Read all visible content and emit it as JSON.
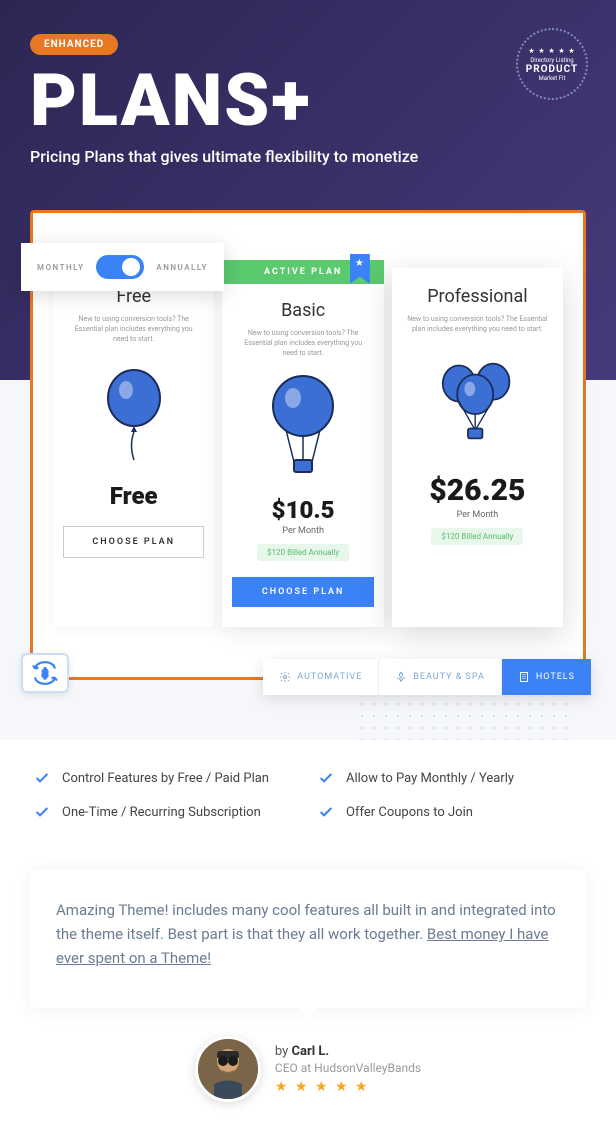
{
  "hero": {
    "badge": "ENHANCED",
    "title": "PLANS+",
    "subtitle": "Pricing Plans that gives ultimate flexibility to monetize"
  },
  "seal": {
    "line1": "Directory Listing",
    "line2": "PRODUCT",
    "line3": "Market Fit",
    "stars": "★ ★ ★ ★ ★"
  },
  "toggle": {
    "left": "MONTHLY",
    "right": "ANNUALLY"
  },
  "plans": [
    {
      "name": "Free",
      "desc": "New to using conversion tools? The Essential plan includes everything you need to start.",
      "price": "Free",
      "button": "CHOOSE PLAN"
    },
    {
      "name": "Basic",
      "active_label": "ACTIVE PLAN",
      "desc": "New to using conversion tools? The Essential plan includes everything you need to start.",
      "price": "$10.5",
      "period": "Per Month",
      "billed": "$120 Billed Annually",
      "button": "CHOOSE PLAN"
    },
    {
      "name": "Professional",
      "desc": "New to using conversion tools? The Essential plan includes everything you need to start.",
      "price": "$26.25",
      "period": "Per Month",
      "billed": "$120 Billed Annually"
    }
  ],
  "categories": [
    "AUTOMATIVE",
    "BEAUTY & SPA",
    "HOTELS"
  ],
  "features": [
    "Control Features by Free / Paid Plan",
    "Allow to Pay Monthly / Yearly",
    "One-Time / Recurring Subscription",
    "Offer Coupons to Join"
  ],
  "testimonial": {
    "text_before": "Amazing Theme! includes many cool features all built in and integrated into the theme itself. Best part is that they all work together. ",
    "highlight": "Best money I have ever spent on a Theme!",
    "author_prefix": "by ",
    "author_name": "Carl L.",
    "author_role": "CEO at HudsonValleyBands",
    "stars": "★ ★ ★ ★ ★"
  }
}
